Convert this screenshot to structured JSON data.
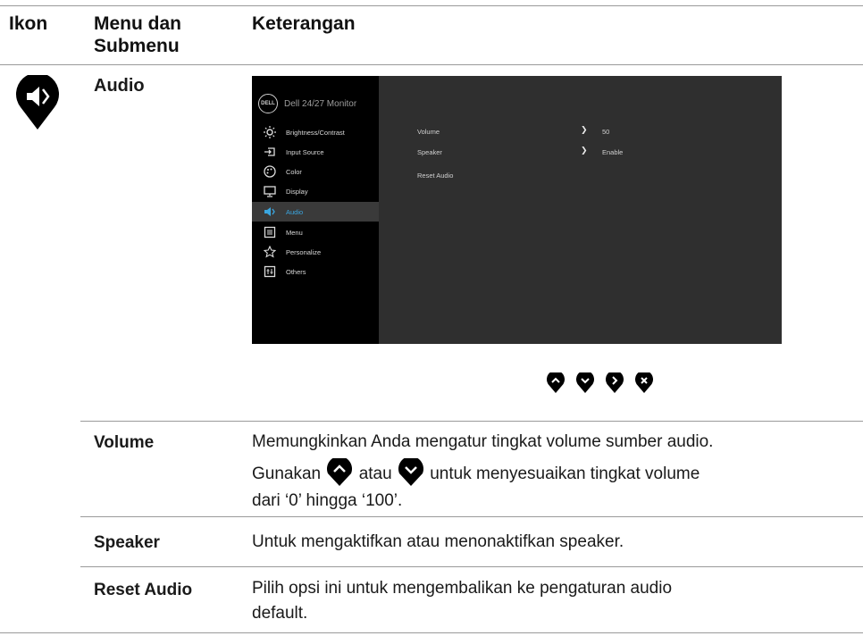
{
  "header": {
    "col_icon": "Ikon",
    "col_menu_line1": "Menu dan",
    "col_menu_line2": "Submenu",
    "col_desc": "Keterangan"
  },
  "section": {
    "title": "Audio",
    "icon": "speaker-pin-icon"
  },
  "osd": {
    "brand": "DELL",
    "model": "Dell 24/27 Monitor",
    "menu": [
      {
        "label": "Brightness/Contrast",
        "icon": "brightness-icon"
      },
      {
        "label": "Input Source",
        "icon": "input-source-icon"
      },
      {
        "label": "Color",
        "icon": "color-icon"
      },
      {
        "label": "Display",
        "icon": "display-icon"
      },
      {
        "label": "Audio",
        "icon": "audio-icon",
        "active": true
      },
      {
        "label": "Menu",
        "icon": "menu-icon"
      },
      {
        "label": "Personalize",
        "icon": "star-icon"
      },
      {
        "label": "Others",
        "icon": "others-icon"
      }
    ],
    "settings": [
      {
        "label": "Volume",
        "value": "50"
      },
      {
        "label": "Speaker",
        "value": "Enable"
      },
      {
        "label": "Reset Audio",
        "value": ""
      }
    ],
    "accent_color": "#3aa6e0"
  },
  "nav_buttons": [
    "up-button",
    "down-button",
    "right-button",
    "close-button"
  ],
  "rows": [
    {
      "label": "Volume",
      "line1": "Memungkinkan Anda mengatur tingkat volume sumber audio.",
      "line2_a": "Gunakan",
      "line2_b": "atau",
      "line2_c": "untuk menyesuaikan tingkat volume",
      "line3": "dari ‘0’ hingga ‘100’."
    },
    {
      "label": "Speaker",
      "line1": "Untuk mengaktifkan atau menonaktifkan speaker."
    },
    {
      "label": "Reset Audio",
      "line1": "Pilih opsi ini untuk mengembalikan ke pengaturan audio",
      "line2": "default."
    }
  ]
}
